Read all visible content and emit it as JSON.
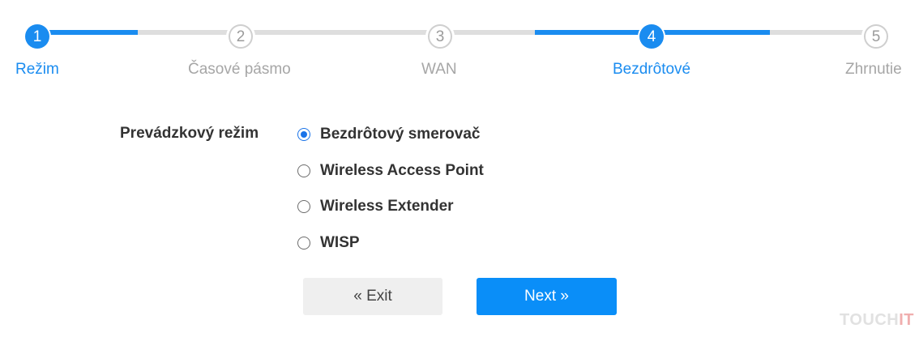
{
  "stepper": {
    "steps": [
      {
        "number": "1",
        "label": "Režim",
        "state": "active"
      },
      {
        "number": "2",
        "label": "Časové pásmo",
        "state": "inactive"
      },
      {
        "number": "3",
        "label": "WAN",
        "state": "inactive"
      },
      {
        "number": "4",
        "label": "Bezdrôtové",
        "state": "active"
      },
      {
        "number": "5",
        "label": "Zhrnutie",
        "state": "inactive"
      }
    ]
  },
  "form": {
    "mode_label": "Prevádzkový režim",
    "options": [
      {
        "label": "Bezdrôtový smerovač",
        "checked": true
      },
      {
        "label": "Wireless Access Point",
        "checked": false
      },
      {
        "label": "Wireless Extender",
        "checked": false
      },
      {
        "label": "WISP",
        "checked": false
      }
    ]
  },
  "buttons": {
    "exit_label": "« Exit",
    "next_label": "Next »"
  },
  "watermark": {
    "prefix": "TOUCH",
    "accent": "IT"
  },
  "colors": {
    "accent": "#1a8cf0",
    "next_button": "#0a8ef8",
    "inactive_track": "#dedede"
  }
}
